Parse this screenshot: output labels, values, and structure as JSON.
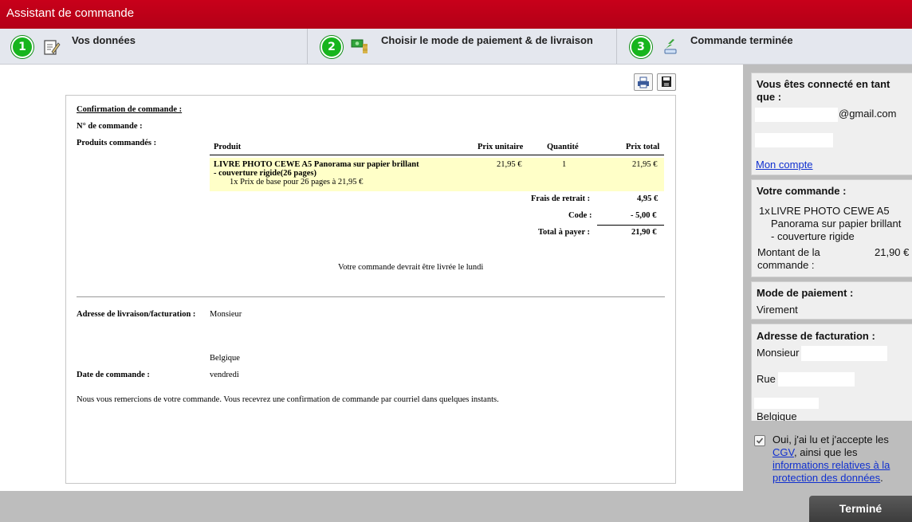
{
  "window": {
    "title": "Assistant de commande"
  },
  "steps": [
    {
      "num": "1",
      "label": "Vos données"
    },
    {
      "num": "2",
      "label": "Choisir le mode de paiement & de livraison"
    },
    {
      "num": "3",
      "label": "Commande terminée"
    }
  ],
  "doc": {
    "heading": "Confirmation de commande :",
    "order_no_label": "N° de commande :",
    "products_label": "Produits commandés :",
    "columns": [
      "Produit",
      "Prix unitaire",
      "Quantité",
      "Prix total"
    ],
    "product": {
      "name_line1": "LIVRE PHOTO CEWE A5 Panorama sur papier brillant",
      "name_line2": "- couverture rigide(26 pages)",
      "detail": "1x Prix de base pour 26 pages à 21,95 €",
      "unit_price": "21,95 €",
      "qty": "1",
      "total": "21,95 €"
    },
    "shipping_label": "Frais de retrait :",
    "shipping_value": "4,95 €",
    "code_label": "Code :",
    "code_value": "- 5,00 €",
    "total_label": "Total à payer :",
    "total_value": "21,90 €",
    "delivery_note": "Votre commande devrait être livrée le lundi",
    "address_label": "Adresse de livraison/facturation :",
    "address_salutation": "Monsieur",
    "address_country": "Belgique",
    "date_label": "Date de commande :",
    "date_value": "vendredi",
    "thanks": "Nous vous remercions de votre commande. Vous recevrez une confirmation de commande par courriel dans quelques instants."
  },
  "sidebar": {
    "user_title_line1": "Vous êtes connecté en tant",
    "user_title_line2": "que :",
    "email_suffix": "@gmail.com",
    "account_link": "Mon compte",
    "order_title": "Votre commande :",
    "order_qty": "1x",
    "order_item_line1": "LIVRE PHOTO CEWE A5",
    "order_item_line2": "Panorama sur papier brillant",
    "order_item_line3": "- couverture rigide",
    "amount_label_line1": "Montant de la",
    "amount_label_line2": "commande :",
    "amount_value": "21,90 €",
    "payment_title": "Mode de paiement :",
    "payment_value": "Virement",
    "billing_title": "Adresse de facturation :",
    "billing_salutation": "Monsieur",
    "billing_street": "Rue",
    "billing_country": "Belgique"
  },
  "terms": {
    "line1": "Oui, j'ai lu et j'accepte les",
    "cgv_link": "CGV",
    "line2_rest": ", ainsi que les",
    "privacy_link_line1": "informations relatives à la",
    "privacy_link_line2": "protection des données",
    "period": "."
  },
  "finish_button": "Terminé"
}
